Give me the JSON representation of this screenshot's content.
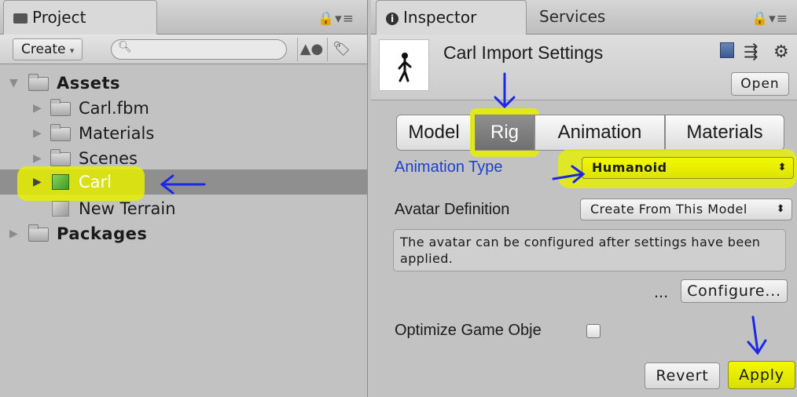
{
  "project": {
    "tab_label": "Project",
    "create_label": "Create",
    "tree": [
      {
        "label": "Assets"
      },
      {
        "label": "Carl.fbm"
      },
      {
        "label": "Materials"
      },
      {
        "label": "Scenes"
      },
      {
        "label": "Carl"
      },
      {
        "label": "New Terrain"
      },
      {
        "label": "Packages"
      }
    ]
  },
  "inspector": {
    "tabs": [
      {
        "label": "Inspector"
      },
      {
        "label": "Services"
      }
    ],
    "title": "Carl Import Settings",
    "open_label": "Open",
    "segments": [
      {
        "label": "Model"
      },
      {
        "label": "Rig"
      },
      {
        "label": "Animation"
      },
      {
        "label": "Materials"
      }
    ],
    "selected_segment": "Rig",
    "animation_type": {
      "label": "Animation Type",
      "value": "Humanoid"
    },
    "avatar_definition": {
      "label": "Avatar Definition",
      "value": "Create From This Model"
    },
    "help_text": "The avatar can be configured after settings have been applied.",
    "ellipsis": "...",
    "configure_label": "Configure...",
    "optimize_label": "Optimize Game Obje",
    "optimize_checked": false,
    "revert_label": "Revert",
    "apply_label": "Apply"
  },
  "colors": {
    "highlight": "#e6f000",
    "annotation_arrow": "#1a28e6",
    "link_label": "#1f3fcf",
    "selected_segment": "#7a7a7a"
  }
}
